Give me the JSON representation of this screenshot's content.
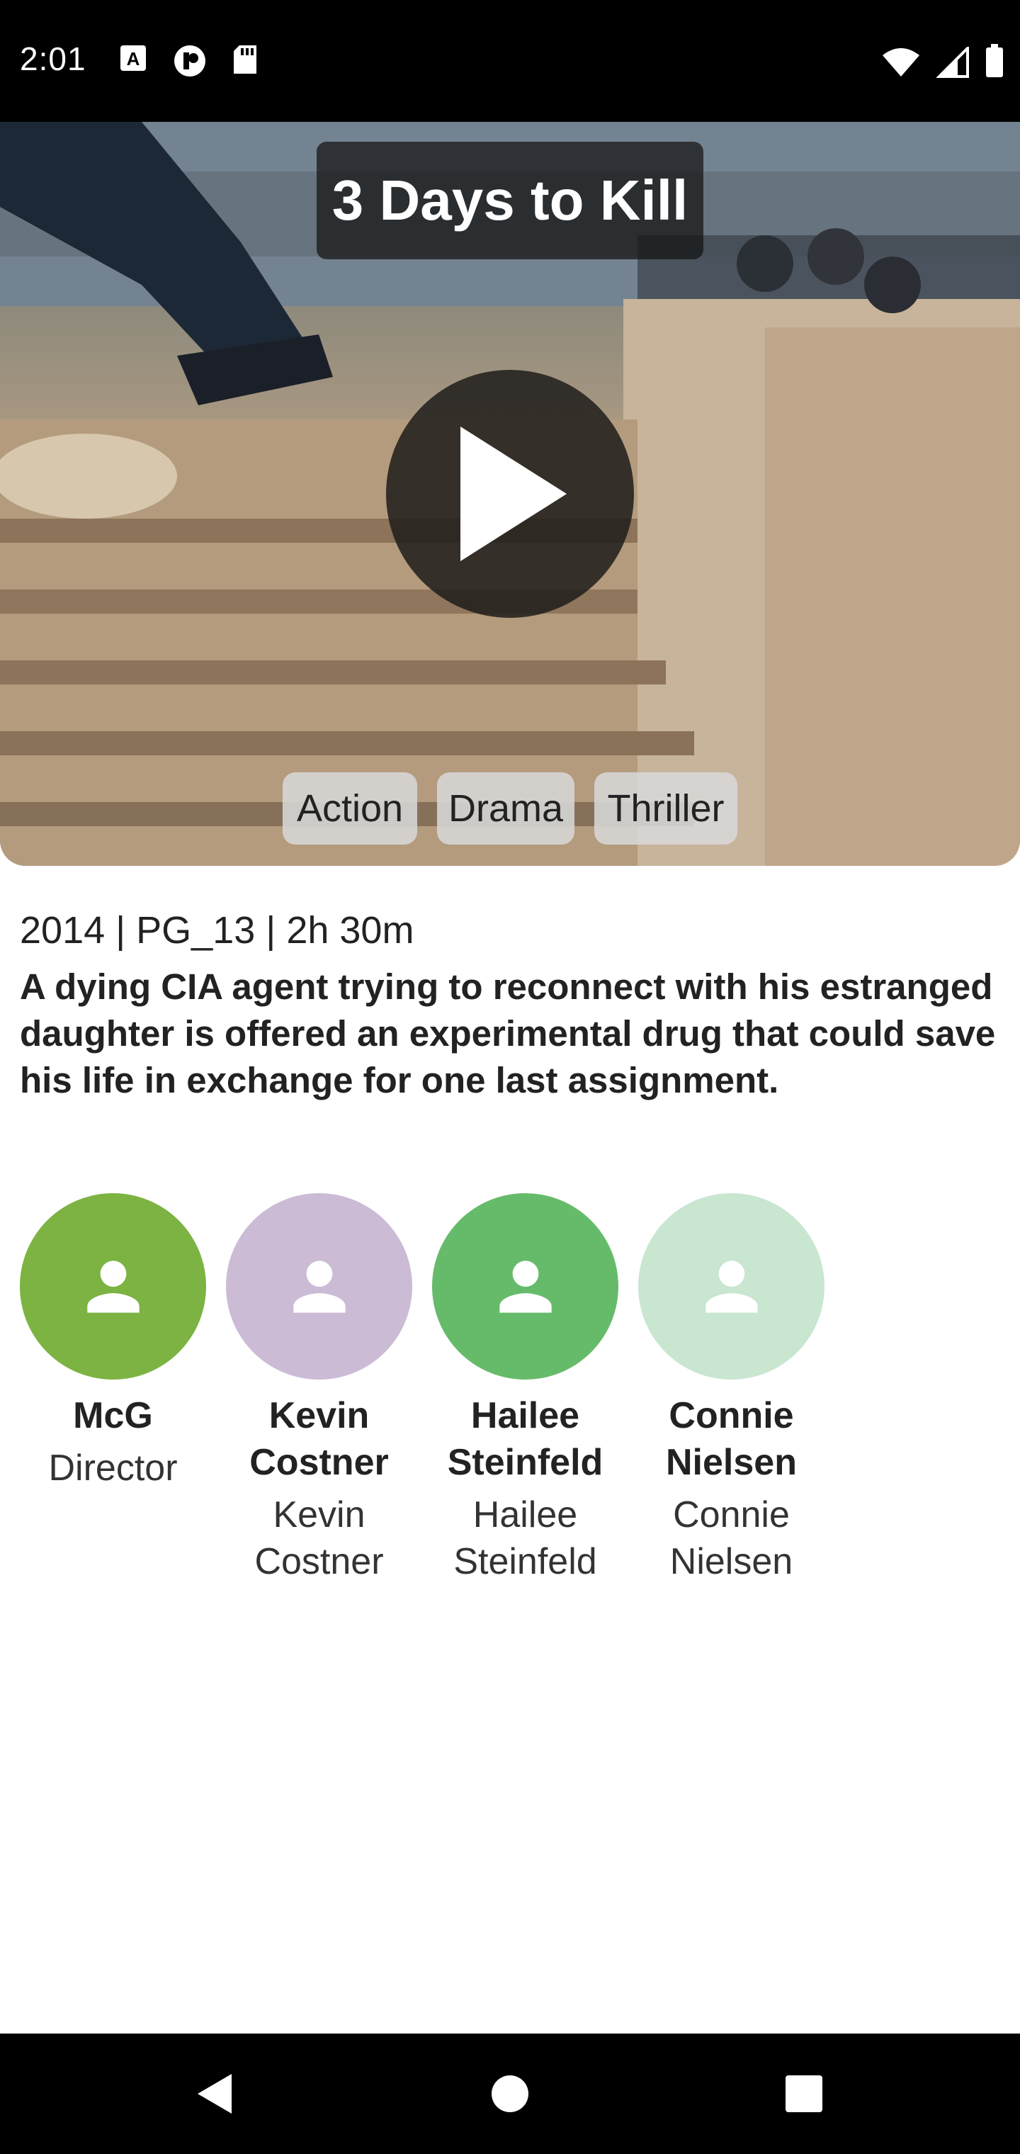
{
  "status_bar": {
    "time": "2:01",
    "left_icons": [
      "a-text-icon",
      "podcast-icon",
      "sd-card-icon"
    ],
    "right_icons": [
      "wifi-icon",
      "cell-signal-icon",
      "battery-icon"
    ]
  },
  "movie": {
    "title": "3 Days to Kill",
    "genres": [
      "Action",
      "Drama",
      "Thriller"
    ],
    "meta": "2014 | PG_13 | 2h  30m",
    "synopsis": "A dying CIA agent trying to reconnect with his estranged daughter is offered an experimental drug that could save his life in exchange for one last assignment."
  },
  "people": [
    {
      "name": "McG",
      "role": "Director",
      "avatar_color": "#7cb342"
    },
    {
      "name": "Kevin Costner",
      "role": "Kevin Costner",
      "avatar_color": "#cbbbd5"
    },
    {
      "name": "Hailee Steinfeld",
      "role": "Hailee Steinfeld",
      "avatar_color": "#66bb6a"
    },
    {
      "name": "Connie Nielsen",
      "role": "Connie Nielsen",
      "avatar_color": "#c8e6d0"
    }
  ],
  "nav": [
    "back-icon",
    "home-icon",
    "recents-icon"
  ]
}
